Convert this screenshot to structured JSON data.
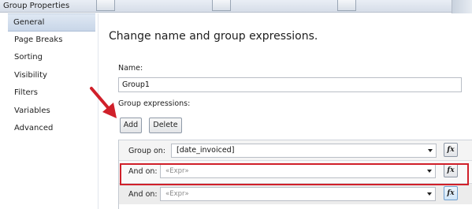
{
  "window": {
    "title": "Group Properties"
  },
  "sidebar": {
    "items": [
      {
        "label": "General",
        "selected": true
      },
      {
        "label": "Page Breaks"
      },
      {
        "label": "Sorting"
      },
      {
        "label": "Visibility"
      },
      {
        "label": "Filters"
      },
      {
        "label": "Variables"
      },
      {
        "label": "Advanced"
      }
    ]
  },
  "main": {
    "heading": "Change name and group expressions.",
    "name_label": "Name:",
    "name_value": "Group1",
    "group_expressions_label": "Group expressions:",
    "add_label": "Add",
    "delete_label": "Delete",
    "group_rows": [
      {
        "label": "Group on:",
        "value": "[date_invoiced]",
        "fx_label": "fx"
      },
      {
        "label": "And on:",
        "value": "«Expr»",
        "fx_label": "fx"
      },
      {
        "label": "And on:",
        "value": "«Expr»",
        "fx_label": "fx"
      }
    ]
  },
  "colors": {
    "callout_red": "#d0202a",
    "selected_bg": "#c8d6e8"
  }
}
